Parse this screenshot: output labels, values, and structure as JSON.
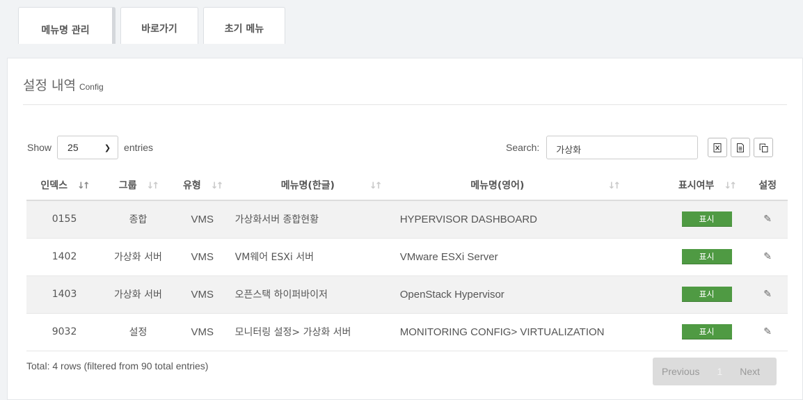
{
  "tabs": [
    {
      "label": "메뉴명 관리",
      "active": true
    },
    {
      "label": "바로가기",
      "active": false
    },
    {
      "label": "초기 메뉴",
      "active": false
    }
  ],
  "panel": {
    "title": "설정 내역",
    "subtitle": "Config"
  },
  "length": {
    "show_label": "Show",
    "value": "25",
    "entries_label": "entries"
  },
  "search": {
    "label": "Search:",
    "value": "가상화"
  },
  "export_icons": [
    "excel-export-icon",
    "csv-export-icon",
    "copy-icon"
  ],
  "columns": [
    "인덱스",
    "그룹",
    "유형",
    "메뉴명(한글)",
    "메뉴명(영어)",
    "표시여부",
    "설정"
  ],
  "rows": [
    {
      "index": "0155",
      "group": "종합",
      "type": "VMS",
      "name_ko": "가상화서버 종합현황",
      "name_en": "HYPERVISOR DASHBOARD",
      "display": "표시"
    },
    {
      "index": "1402",
      "group": "가상화 서버",
      "type": "VMS",
      "name_ko": "VM웨어 ESXi 서버",
      "name_en": "VMware ESXi Server",
      "display": "표시"
    },
    {
      "index": "1403",
      "group": "가상화 서버",
      "type": "VMS",
      "name_ko": "오픈스택 하이퍼바이저",
      "name_en": "OpenStack Hypervisor",
      "display": "표시"
    },
    {
      "index": "9032",
      "group": "설정",
      "type": "VMS",
      "name_ko": "모니터링 설정> 가상화 서버",
      "name_en": "MONITORING CONFIG> VIRTUALIZATION",
      "display": "표시"
    }
  ],
  "footer": {
    "info": "Total: 4 rows (filtered from 90 total entries)"
  },
  "pagination": {
    "previous": "Previous",
    "current": "1",
    "next": "Next"
  },
  "colors": {
    "badge": "#4f9a43"
  }
}
